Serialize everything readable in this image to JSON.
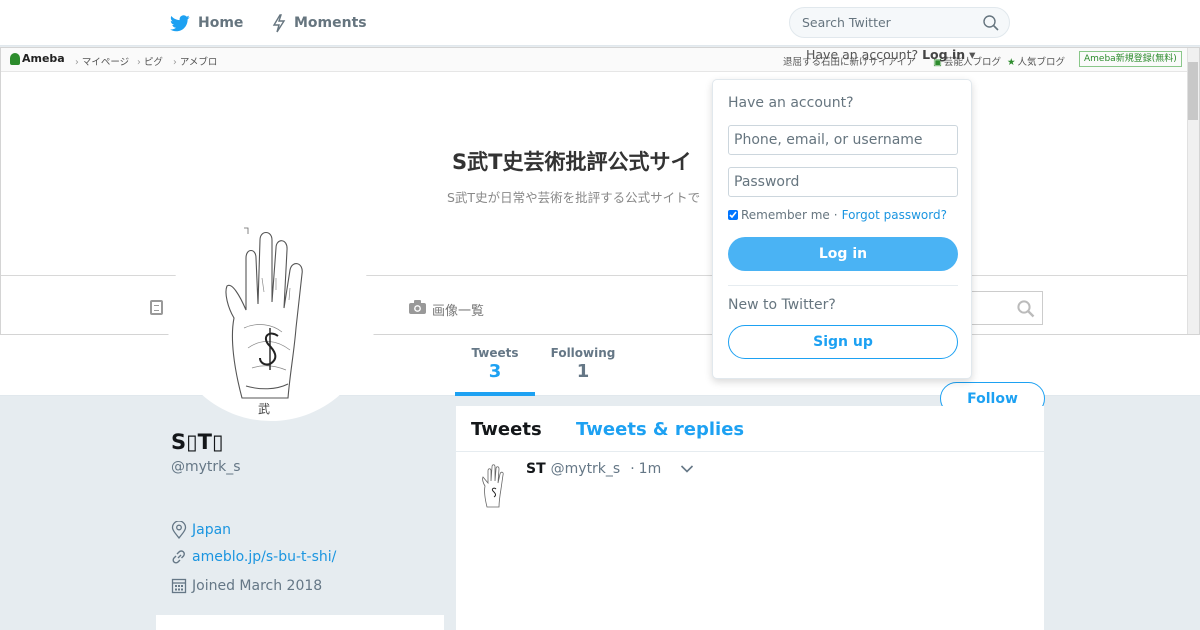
{
  "topnav": {
    "home_label": "Home",
    "moments_label": "Moments",
    "search_placeholder": "Search Twitter"
  },
  "banner": {
    "ameba_logo": "Ameba",
    "links": [
      "マイページ",
      "ピグ",
      "アメブロ"
    ],
    "right_text": "退屈する石田に新けサイアイア",
    "popular_blog_1": "芸能人ブログ",
    "popular_blog_2": "人気ブログ",
    "register_label": "Ameba新規登録(無料)",
    "blog_title": "S武T史芸術批評公式サイ",
    "blog_subtitle": "S武T史が日常や芸術を批評する公式サイトで",
    "image_list_label": "画像一覧",
    "have_account": "Have an account?",
    "login_mini": "Log in"
  },
  "profile": {
    "tweets_label": "Tweets",
    "tweets_count": "3",
    "following_label": "Following",
    "following_count": "1",
    "follow_button": "Follow",
    "name": "S▯T▯",
    "handle": "@mytrk_s",
    "location": "Japan",
    "url": "ameblo.jp/s-bu-t-shi/",
    "joined": "Joined March 2018"
  },
  "timeline": {
    "tab_tweets": "Tweets",
    "tab_replies": "Tweets & replies",
    "tweet": {
      "name": "ST",
      "handle": "@mytrk_s",
      "dot": "·",
      "time": "1m"
    }
  },
  "login_dropdown": {
    "title": "Have an account?",
    "phone_placeholder": "Phone, email, or username",
    "password_placeholder": "Password",
    "remember_label": "Remember me",
    "separator": "·",
    "forgot_label": "Forgot password?",
    "login_button": "Log in",
    "new_label": "New to Twitter?",
    "signup_button": "Sign up"
  },
  "colors": {
    "twitter_blue": "#1da1f2",
    "link_blue": "#1b95e0",
    "background": "#e6ecf0",
    "ameba_green": "#2d8c2d"
  }
}
